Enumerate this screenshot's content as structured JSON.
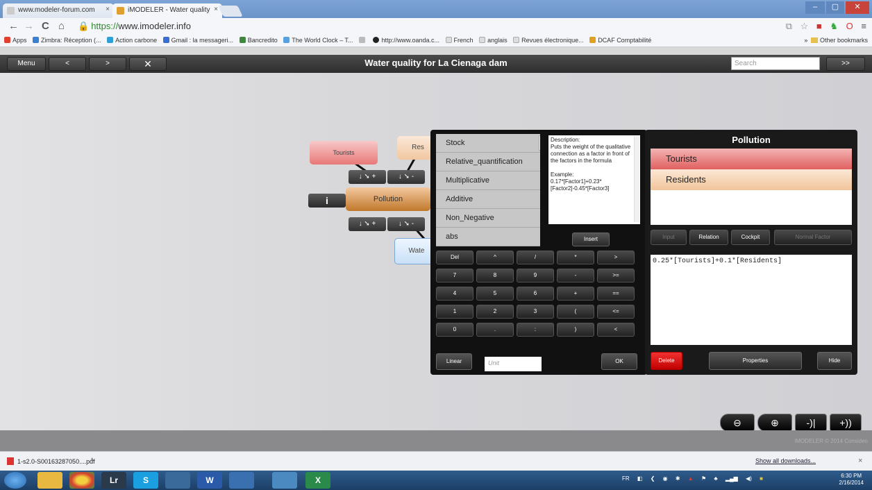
{
  "browser": {
    "tabs": [
      {
        "title": "www.modeler-forum.com",
        "close": "×"
      },
      {
        "title": "iMODELER - Water quality",
        "close": "×"
      }
    ],
    "window_controls": [
      "–",
      "▢",
      "✕"
    ],
    "url_prefix": "https://",
    "url_domain": "www.imodeler.info",
    "bookmarks": [
      {
        "label": "Apps",
        "color": "#e04030"
      },
      {
        "label": "Zimbra: Réception (...",
        "color": "#3b7fd0"
      },
      {
        "label": "Action carbone",
        "color": "#2f9fd8"
      },
      {
        "label": "Gmail : la messageri...",
        "color": "#3a6fd0"
      },
      {
        "label": "Bancredito",
        "color": "#3a8a3a"
      },
      {
        "label": "The World Clock – T...",
        "color": "#5aa0e0"
      },
      {
        "label": "",
        "color": "#bbbbbb"
      },
      {
        "label": "http://www.oanda.c...",
        "color": "#222222"
      },
      {
        "label": "French",
        "color": "#cccccc"
      },
      {
        "label": "anglais",
        "color": "#cccccc"
      },
      {
        "label": "Revues électronique...",
        "color": "#cccccc"
      },
      {
        "label": "DCAF Comptabilité",
        "color": "#e0a020"
      }
    ],
    "bookmarks_more": "»",
    "other_bookmarks": "Other bookmarks"
  },
  "app": {
    "menu": "Menu",
    "back": "<",
    "forward": ">",
    "collapse": "✕",
    "title": "Water quality for La Cienaga dam",
    "search_placeholder": "Search",
    "go": ">>"
  },
  "canvas": {
    "nodes": {
      "tourists": "Tourists",
      "residents": "Res",
      "pollution": "Pollution",
      "water": "Wate"
    },
    "info_button": "i",
    "connector_plus": "+",
    "connector_minus": "-"
  },
  "formula_panel": {
    "functions": [
      "Stock",
      "Relative_quantification",
      "Multiplicative",
      "Additive",
      "Non_Negative",
      "abs"
    ],
    "description": "Description:\nPuts the weight of the qualitative connection as a factor in front of the factors in the formula\n\nExample:\n0.17*[Factor1]+0.23*[Factor2]-0.45*[Factor3]",
    "insert": "Insert",
    "keys": [
      [
        "Del",
        "^",
        "/",
        "*",
        ">"
      ],
      [
        "7",
        "8",
        "9",
        "-",
        ">="
      ],
      [
        "4",
        "5",
        "6",
        "+",
        "=="
      ],
      [
        "1",
        "2",
        "3",
        "(",
        "<="
      ],
      [
        "0",
        ".",
        ":",
        ")",
        "<"
      ]
    ],
    "linear": "Linear",
    "unit_placeholder": "Unit",
    "ok": "OK"
  },
  "properties_panel": {
    "title": "Pollution",
    "factors": [
      "Tourists",
      "Residents"
    ],
    "tabs": [
      "Input",
      "Relation",
      "Cockpit",
      "Normal Factor"
    ],
    "formula": "0.25*[Tourists]+0.1*[Residents]",
    "delete": "Delete",
    "properties": "Properties",
    "hide": "Hide"
  },
  "zoom": {
    "out": "−",
    "in": "+",
    "collapse": "-)|",
    "expand": "+))"
  },
  "footer": {
    "copyright": "iMODELER © 2014 Consideo"
  },
  "downloads": {
    "file": "1-s2.0-S00163287050....pdf",
    "menu": "˄",
    "show_all": "Show all downloads...",
    "close": "×"
  },
  "taskbar": {
    "apps": [
      {
        "label": "",
        "color": "#3a8fd8"
      },
      {
        "label": "",
        "color": "#e8b840"
      },
      {
        "label": "",
        "color": "#d84030"
      },
      {
        "label": "Lr",
        "color": "#2a3a4a"
      },
      {
        "label": "S",
        "color": "#1aa0e0"
      },
      {
        "label": "",
        "color": "#3a6a9a"
      },
      {
        "label": "W",
        "color": "#2a5aa8"
      },
      {
        "label": "",
        "color": "#3a70b0"
      },
      {
        "label": "",
        "color": "#4a8ac0"
      },
      {
        "label": "X",
        "color": "#2a8a4a"
      }
    ],
    "lang": "FR",
    "time": "6:30 PM",
    "date": "2/16/2014"
  }
}
